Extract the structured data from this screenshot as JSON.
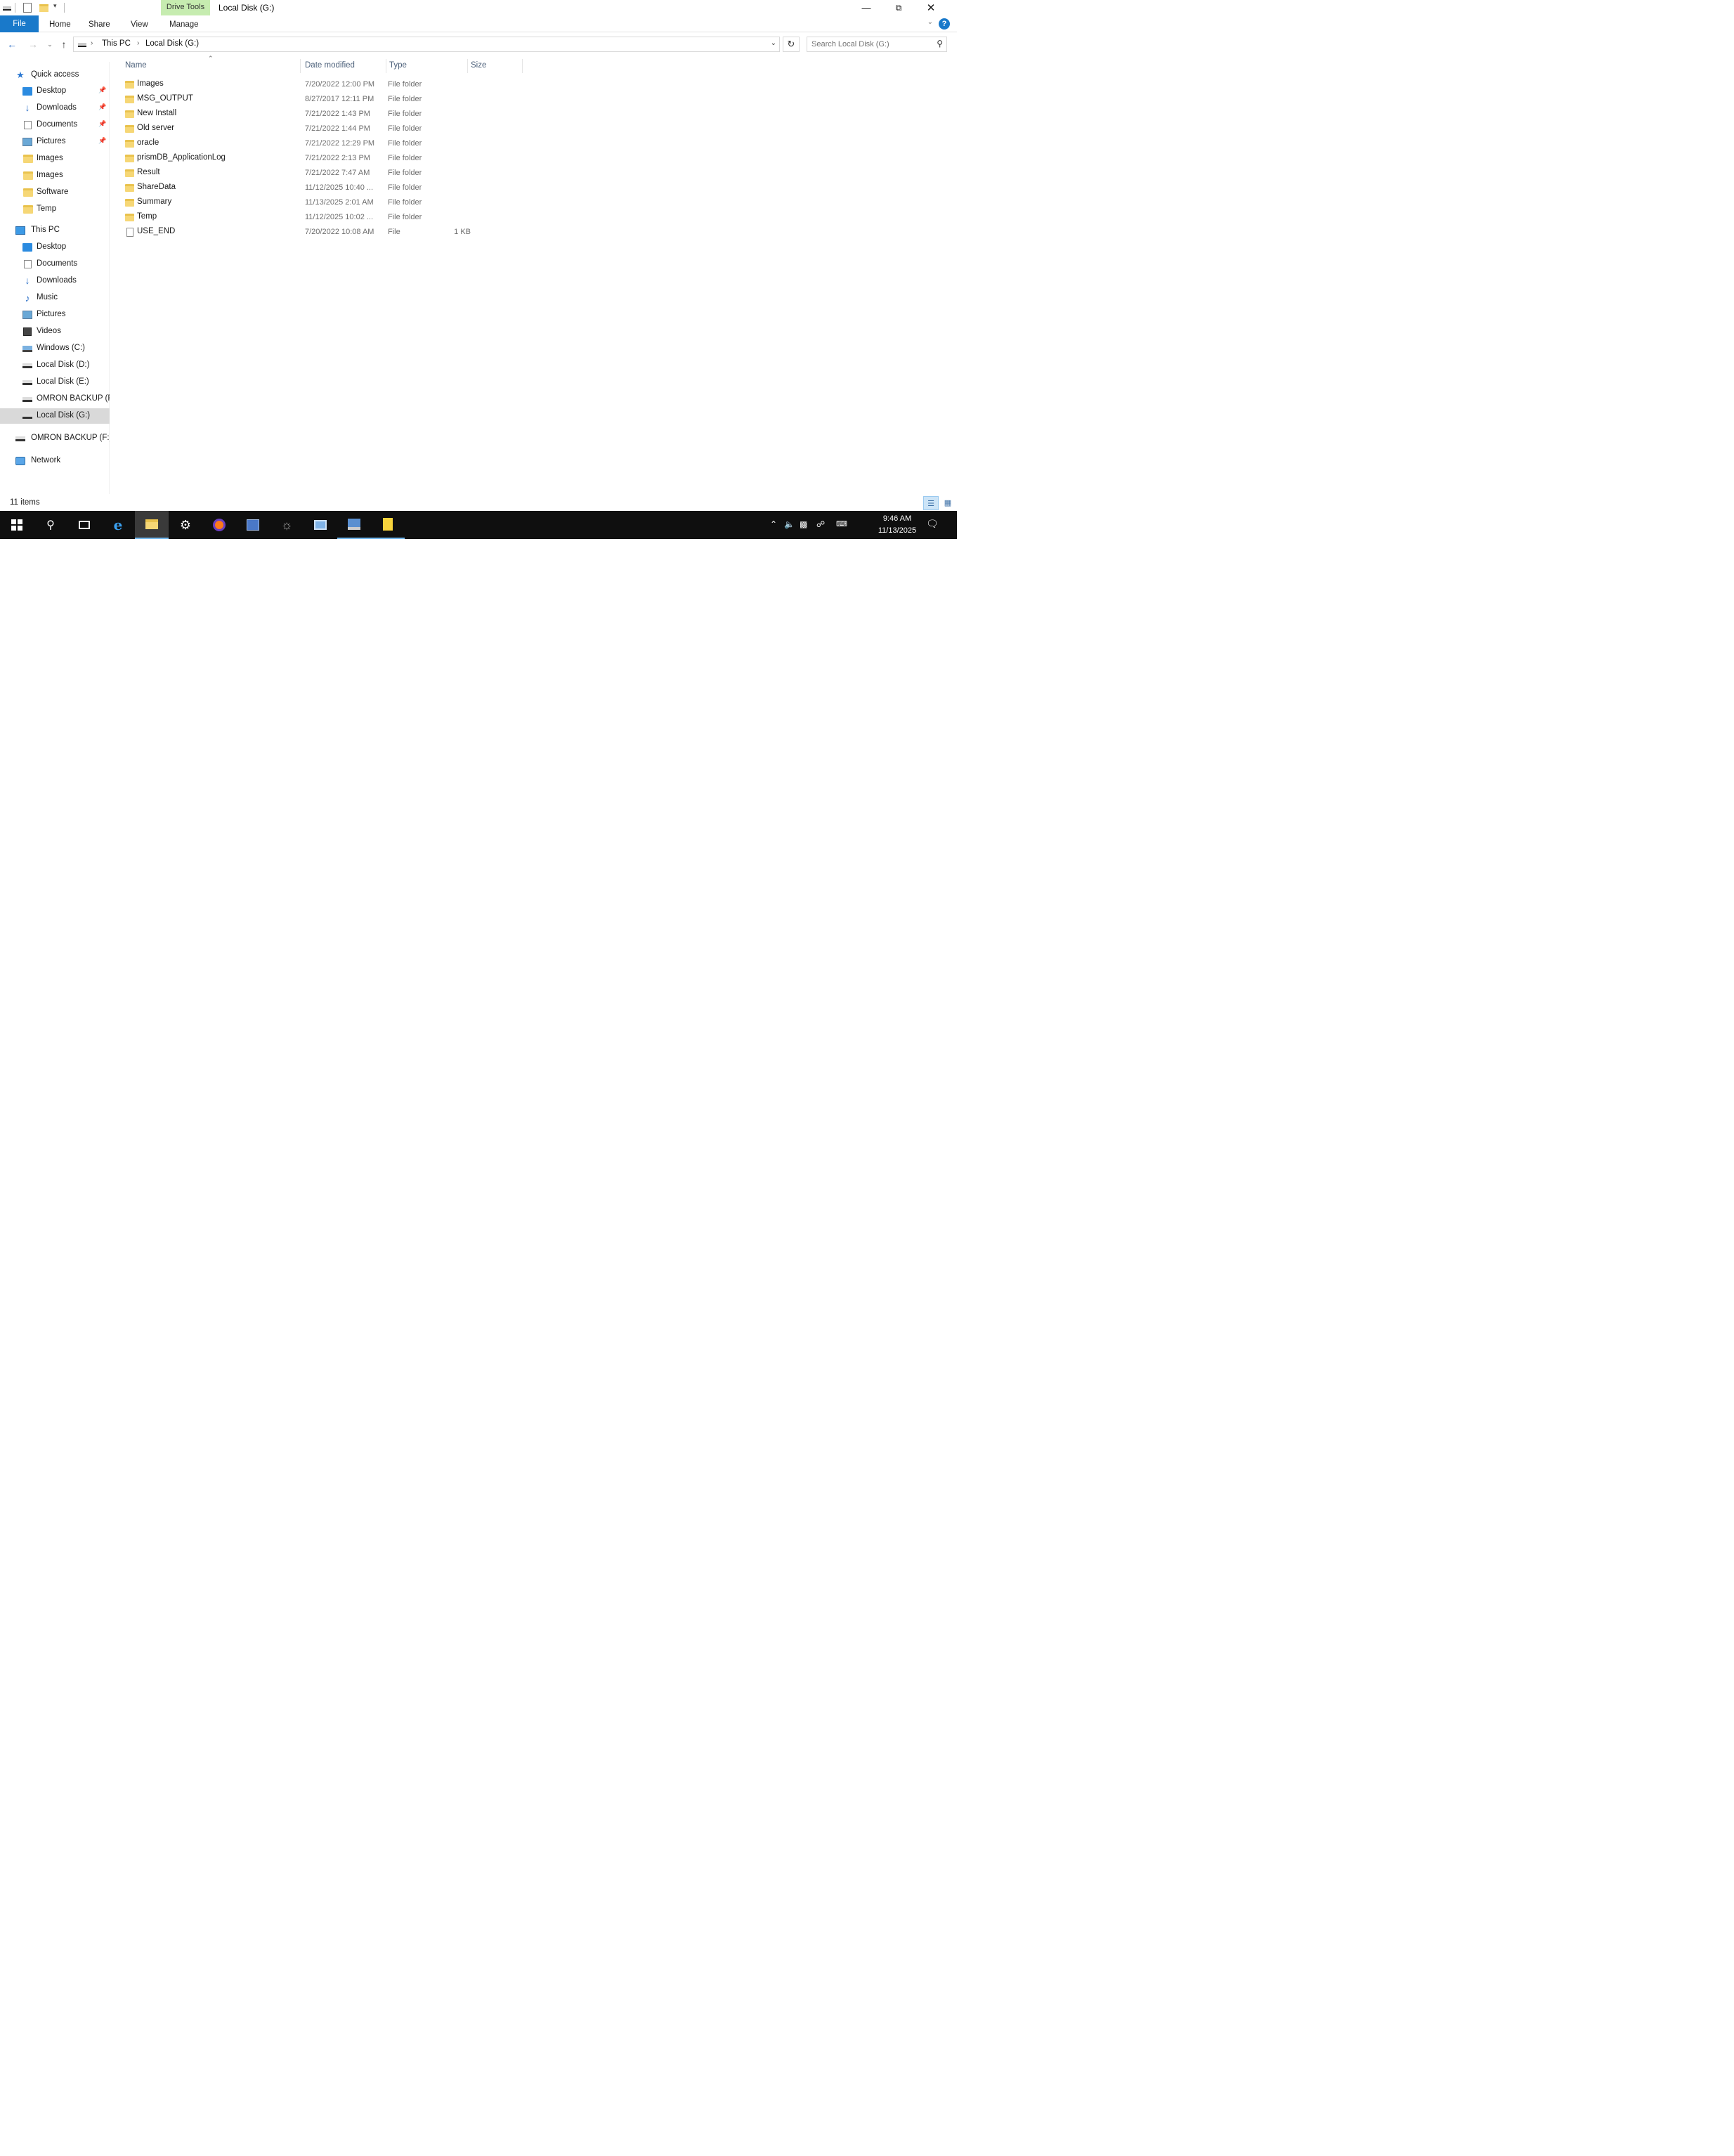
{
  "window": {
    "title": "Local Disk (G:)",
    "contextual_tab": "Drive Tools"
  },
  "ribbon": {
    "tabs": [
      "File",
      "Home",
      "Share",
      "View",
      "Manage"
    ]
  },
  "address": {
    "crumbs": [
      "This PC",
      "Local Disk (G:)"
    ],
    "search_placeholder": "Search Local Disk (G:)"
  },
  "nav": {
    "quick_access": "Quick access",
    "quick_items": [
      {
        "label": "Desktop",
        "icon": "desktop-icon",
        "pinned": true
      },
      {
        "label": "Downloads",
        "icon": "downloads-icon",
        "pinned": true
      },
      {
        "label": "Documents",
        "icon": "documents-icon",
        "pinned": true
      },
      {
        "label": "Pictures",
        "icon": "pictures-icon",
        "pinned": true
      },
      {
        "label": "Images",
        "icon": "folder-icon",
        "pinned": false
      },
      {
        "label": "Images",
        "icon": "folder-icon",
        "pinned": false
      },
      {
        "label": "Software",
        "icon": "folder-icon",
        "pinned": false
      },
      {
        "label": "Temp",
        "icon": "folder-icon",
        "pinned": false
      }
    ],
    "this_pc": "This PC",
    "pc_items": [
      {
        "label": "Desktop",
        "icon": "desktop-icon"
      },
      {
        "label": "Documents",
        "icon": "documents-icon"
      },
      {
        "label": "Downloads",
        "icon": "downloads-icon"
      },
      {
        "label": "Music",
        "icon": "music-icon"
      },
      {
        "label": "Pictures",
        "icon": "pictures-icon"
      },
      {
        "label": "Videos",
        "icon": "videos-icon"
      },
      {
        "label": "Windows (C:)",
        "icon": "windows-drive-icon"
      },
      {
        "label": "Local Disk (D:)",
        "icon": "drive-icon"
      },
      {
        "label": "Local Disk (E:)",
        "icon": "drive-icon"
      },
      {
        "label": "OMRON BACKUP (F",
        "icon": "drive-icon"
      },
      {
        "label": "Local Disk (G:)",
        "icon": "drive-icon",
        "selected": true
      }
    ],
    "omron": "OMRON BACKUP (F:)",
    "network": "Network"
  },
  "columns": {
    "name": "Name",
    "date": "Date modified",
    "type": "Type",
    "size": "Size"
  },
  "files": [
    {
      "name": "Images",
      "date": "7/20/2022 12:00 PM",
      "type": "File folder",
      "size": "",
      "icon": "folder-icon"
    },
    {
      "name": "MSG_OUTPUT",
      "date": "8/27/2017 12:11 PM",
      "type": "File folder",
      "size": "",
      "icon": "folder-icon"
    },
    {
      "name": "New Install",
      "date": "7/21/2022 1:43 PM",
      "type": "File folder",
      "size": "",
      "icon": "folder-icon"
    },
    {
      "name": "Old server",
      "date": "7/21/2022 1:44 PM",
      "type": "File folder",
      "size": "",
      "icon": "folder-icon"
    },
    {
      "name": "oracle",
      "date": "7/21/2022 12:29 PM",
      "type": "File folder",
      "size": "",
      "icon": "folder-icon"
    },
    {
      "name": "prismDB_ApplicationLog",
      "date": "7/21/2022 2:13 PM",
      "type": "File folder",
      "size": "",
      "icon": "folder-icon"
    },
    {
      "name": "Result",
      "date": "7/21/2022 7:47 AM",
      "type": "File folder",
      "size": "",
      "icon": "folder-icon"
    },
    {
      "name": "ShareData",
      "date": "11/12/2025 10:40 ...",
      "type": "File folder",
      "size": "",
      "icon": "folder-icon"
    },
    {
      "name": "Summary",
      "date": "11/13/2025 2:01 AM",
      "type": "File folder",
      "size": "",
      "icon": "folder-icon"
    },
    {
      "name": "Temp",
      "date": "11/12/2025 10:02 ...",
      "type": "File folder",
      "size": "",
      "icon": "folder-icon"
    },
    {
      "name": "USE_END",
      "date": "7/20/2022 10:08 AM",
      "type": "File",
      "size": "1 KB",
      "icon": "file-icon"
    }
  ],
  "status": {
    "item_count": "11 items"
  },
  "taskbar": {
    "time": "9:46 AM",
    "date": "11/13/2025"
  }
}
